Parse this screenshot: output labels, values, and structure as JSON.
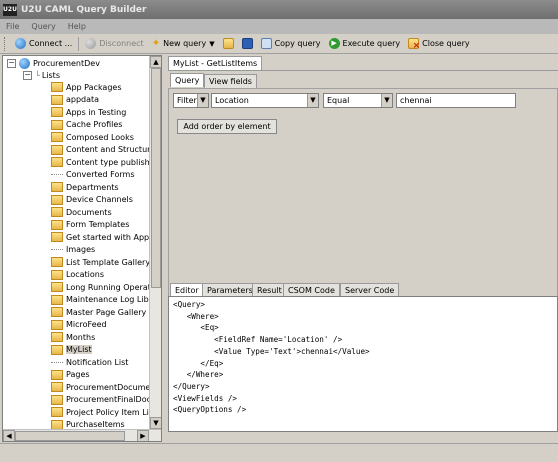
{
  "window": {
    "title": "U2U CAML Query Builder",
    "logo_text": "U2U"
  },
  "menu": [
    "File",
    "Query",
    "Help"
  ],
  "toolbar": {
    "connect": "Connect ...",
    "disconnect": "Disconnect",
    "new_query": "New query",
    "copy_query": "Copy query",
    "execute_query": "Execute query",
    "close_query": "Close query"
  },
  "tree": {
    "root": "ProcurementDev",
    "lists_label": "Lists",
    "selected": "MyList",
    "items": [
      {
        "label": "App Packages",
        "folder": true
      },
      {
        "label": "appdata",
        "folder": true
      },
      {
        "label": "Apps in Testing",
        "folder": true
      },
      {
        "label": "Cache Profiles",
        "folder": true
      },
      {
        "label": "Composed Looks",
        "folder": true
      },
      {
        "label": "Content and Structure",
        "folder": true
      },
      {
        "label": "Content type publishing",
        "folder": true
      },
      {
        "label": "Converted Forms",
        "folder": false
      },
      {
        "label": "Departments",
        "folder": true
      },
      {
        "label": "Device Channels",
        "folder": true
      },
      {
        "label": "Documents",
        "folder": true
      },
      {
        "label": "Form Templates",
        "folder": true
      },
      {
        "label": "Get started with Apps f",
        "folder": true
      },
      {
        "label": "Images",
        "folder": false
      },
      {
        "label": "List Template Gallery",
        "folder": true
      },
      {
        "label": "Locations",
        "folder": true
      },
      {
        "label": "Long Running Operatio",
        "folder": true
      },
      {
        "label": "Maintenance Log Libra",
        "folder": true
      },
      {
        "label": "Master Page Gallery",
        "folder": true
      },
      {
        "label": "MicroFeed",
        "folder": true
      },
      {
        "label": "Months",
        "folder": true
      },
      {
        "label": "MyList",
        "folder": true
      },
      {
        "label": "Notification List",
        "folder": false
      },
      {
        "label": "Pages",
        "folder": true
      },
      {
        "label": "ProcurementDocumen",
        "folder": true
      },
      {
        "label": "ProcurementFinalDocu",
        "folder": true
      },
      {
        "label": "Project Policy Item List",
        "folder": true
      },
      {
        "label": "PurchaseItems",
        "folder": true
      }
    ]
  },
  "document_tab": "MyList - GetListItems",
  "query_tabs": [
    "Query",
    "View fields"
  ],
  "filter": {
    "type": "Filter",
    "field": "Location",
    "operator": "Equal",
    "value": "chennai"
  },
  "add_order_button": "Add order by element",
  "editor_tabs": [
    "Editor",
    "Parameters",
    "Result",
    "CSOM Code",
    "Server Code"
  ],
  "code_lines": [
    "<Query>",
    "   <Where>",
    "      <Eq>",
    "         <FieldRef Name='Location' />",
    "         <Value Type='Text'>chennai</Value>",
    "      </Eq>",
    "   </Where>",
    "</Query>",
    "<ViewFields />",
    "<QueryOptions />"
  ],
  "colors": {
    "folder": "#e6b74a",
    "titlebar": "#7a7a7a",
    "panel": "#d4d0c8"
  }
}
